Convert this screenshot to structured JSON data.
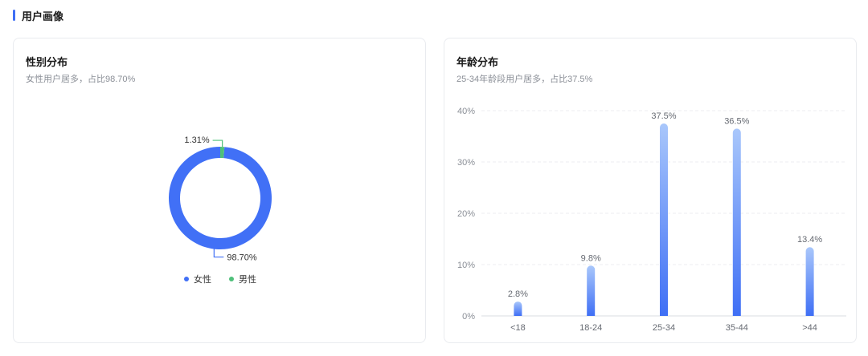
{
  "section": {
    "title": "用户画像"
  },
  "colors": {
    "accent": "#3f6ff5",
    "female": "#4170f6",
    "male": "#4fc07a",
    "bar_top": "#a9c7fb",
    "bar_bottom": "#3f6ff5"
  },
  "gender_card": {
    "title": "性别分布",
    "subtitle": "女性用户居多，占比98.70%"
  },
  "age_card": {
    "title": "年龄分布",
    "subtitle": "25-34年龄段用户居多，占比37.5%"
  },
  "chart_data": [
    {
      "type": "pie",
      "title": "性别分布",
      "labels": [
        "女性",
        "男性"
      ],
      "values": [
        98.7,
        1.31
      ],
      "value_labels": [
        "98.70%",
        "1.31%"
      ],
      "donut": true,
      "legend": "bottom"
    },
    {
      "type": "bar",
      "title": "年龄分布",
      "categories": [
        "<18",
        "18-24",
        "25-34",
        "35-44",
        ">44"
      ],
      "values": [
        2.8,
        9.8,
        37.5,
        36.5,
        13.4
      ],
      "value_labels": [
        "2.8%",
        "9.8%",
        "37.5%",
        "36.5%",
        "13.4%"
      ],
      "ylim": [
        0,
        40
      ],
      "yticks": [
        0,
        10,
        20,
        30,
        40
      ],
      "ytick_labels": [
        "0%",
        "10%",
        "20%",
        "30%",
        "40%"
      ],
      "grid": true
    }
  ]
}
